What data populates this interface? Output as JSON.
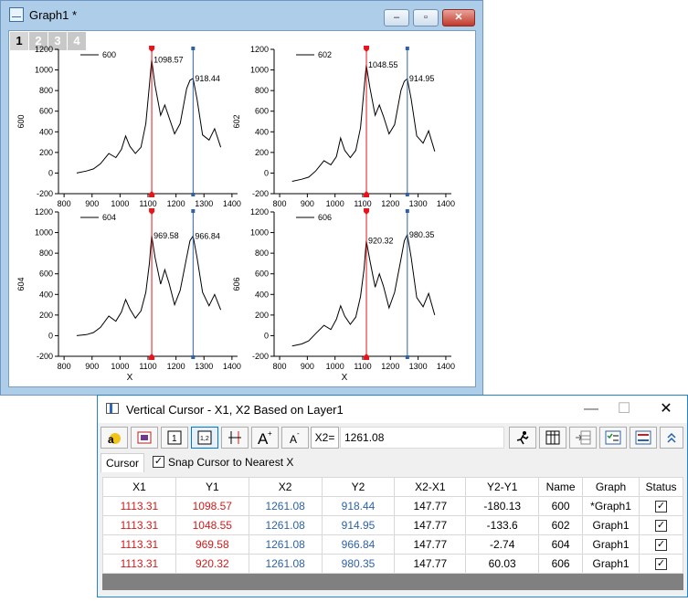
{
  "graph_window": {
    "title": "Graph1 *",
    "page_tabs": [
      "1",
      "2",
      "3",
      "4"
    ],
    "buttons": {
      "minimize": "–",
      "restore": "▫",
      "close": "✕"
    }
  },
  "plots": [
    {
      "legend": "600",
      "ylabel": "600",
      "xlabel": "",
      "peak1": "1098.57",
      "peak2": "918.44"
    },
    {
      "legend": "602",
      "ylabel": "602",
      "xlabel": "",
      "peak1": "1048.55",
      "peak2": "914.95"
    },
    {
      "legend": "604",
      "ylabel": "604",
      "xlabel": "X",
      "peak1": "969.58",
      "peak2": "966.84"
    },
    {
      "legend": "606",
      "ylabel": "606",
      "xlabel": "X",
      "peak1": "920.32",
      "peak2": "980.35"
    }
  ],
  "chart_data": {
    "type": "line",
    "x_ticks": [
      800,
      900,
      1000,
      1100,
      1200,
      1300,
      1400
    ],
    "y_ticks": [
      -200,
      0,
      200,
      400,
      600,
      800,
      1000,
      1200
    ],
    "xlim": [
      780,
      1420
    ],
    "cursor_x1": 1113.31,
    "cursor_x2": 1261.08,
    "series": [
      {
        "name": "600",
        "x": [
          845,
          880,
          905,
          930,
          960,
          985,
          1005,
          1020,
          1035,
          1055,
          1075,
          1092,
          1105,
          1113,
          1125,
          1145,
          1160,
          1175,
          1195,
          1215,
          1238,
          1250,
          1261,
          1275,
          1295,
          1318,
          1338,
          1360
        ],
        "y": [
          0,
          20,
          40,
          90,
          190,
          150,
          230,
          360,
          260,
          190,
          250,
          480,
          850,
          1098,
          850,
          560,
          660,
          540,
          380,
          480,
          820,
          900,
          918,
          720,
          370,
          320,
          430,
          250
        ]
      },
      {
        "name": "602",
        "x": [
          845,
          880,
          905,
          930,
          960,
          985,
          1005,
          1020,
          1035,
          1055,
          1075,
          1092,
          1105,
          1113,
          1125,
          1145,
          1160,
          1175,
          1195,
          1215,
          1238,
          1250,
          1261,
          1275,
          1295,
          1318,
          1338,
          1360
        ],
        "y": [
          -80,
          -60,
          -40,
          20,
          120,
          80,
          160,
          340,
          220,
          150,
          220,
          440,
          820,
          1048,
          840,
          560,
          660,
          550,
          380,
          470,
          800,
          890,
          915,
          720,
          360,
          290,
          410,
          210
        ]
      },
      {
        "name": "604",
        "x": [
          845,
          880,
          905,
          930,
          960,
          985,
          1005,
          1020,
          1035,
          1055,
          1075,
          1092,
          1105,
          1113,
          1125,
          1145,
          1160,
          1175,
          1195,
          1215,
          1238,
          1250,
          1261,
          1275,
          1295,
          1318,
          1338,
          1360
        ],
        "y": [
          0,
          10,
          30,
          80,
          190,
          140,
          230,
          350,
          260,
          170,
          240,
          420,
          700,
          970,
          760,
          500,
          640,
          510,
          300,
          440,
          760,
          920,
          967,
          760,
          420,
          290,
          400,
          250
        ]
      },
      {
        "name": "606",
        "x": [
          845,
          880,
          905,
          930,
          960,
          985,
          1005,
          1020,
          1035,
          1055,
          1075,
          1092,
          1105,
          1113,
          1125,
          1145,
          1160,
          1175,
          1195,
          1215,
          1238,
          1250,
          1261,
          1275,
          1295,
          1318,
          1338,
          1360
        ],
        "y": [
          -100,
          -80,
          -50,
          20,
          100,
          60,
          160,
          290,
          190,
          110,
          180,
          380,
          650,
          920,
          740,
          470,
          600,
          480,
          270,
          420,
          740,
          920,
          980,
          760,
          370,
          280,
          410,
          200
        ]
      }
    ]
  },
  "cursor_window": {
    "title": "Vertical Cursor - X1, X2 Based on Layer1",
    "buttons": {
      "minimize": "—",
      "maximize": "☐",
      "close": "✕"
    },
    "x2_label": "X2=",
    "x2_value": "1261.08",
    "tab_label": "Cursor",
    "snap_label": "Snap Cursor to Nearest X",
    "snap_checked": "✓",
    "columns": [
      "X1",
      "Y1",
      "X2",
      "Y2",
      "X2-X1",
      "Y2-Y1",
      "Name",
      "Graph",
      "Status"
    ],
    "rows": [
      {
        "x1": "1113.31",
        "y1": "1098.57",
        "x2": "1261.08",
        "y2": "918.44",
        "dx": "147.77",
        "dy": "-180.13",
        "name": "600",
        "graph": "*Graph1",
        "status": "✓"
      },
      {
        "x1": "1113.31",
        "y1": "1048.55",
        "x2": "1261.08",
        "y2": "914.95",
        "dx": "147.77",
        "dy": "-133.6",
        "name": "602",
        "graph": "Graph1",
        "status": "✓"
      },
      {
        "x1": "1113.31",
        "y1": "969.58",
        "x2": "1261.08",
        "y2": "966.84",
        "dx": "147.77",
        "dy": "-2.74",
        "name": "604",
        "graph": "Graph1",
        "status": "✓"
      },
      {
        "x1": "1113.31",
        "y1": "920.32",
        "x2": "1261.08",
        "y2": "980.35",
        "dx": "147.77",
        "dy": "60.03",
        "name": "606",
        "graph": "Graph1",
        "status": "✓"
      }
    ]
  },
  "colors": {
    "cursor1": "#e8141b",
    "cursor2": "#2e62a8"
  }
}
